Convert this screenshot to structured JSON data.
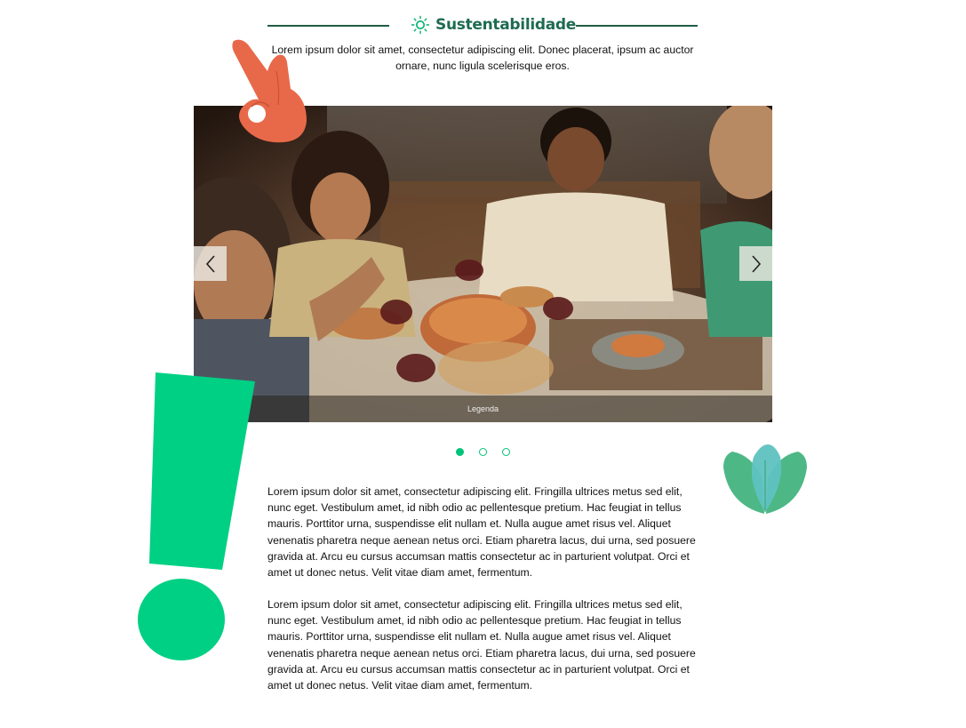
{
  "header": {
    "title": "Sustentabilidade",
    "icon": "sun-icon",
    "intro": "Lorem ipsum dolor sit amet, consectetur adipiscing elit. Donec placerat, ipsum ac auctor ornare, nunc ligula scelerisque eros."
  },
  "carousel": {
    "caption": "Legenda",
    "prev_icon": "chevron-left-icon",
    "next_icon": "chevron-right-icon",
    "slides_total": 3,
    "active_slide": 1
  },
  "body": {
    "paragraphs": [
      "Lorem ipsum dolor sit amet, consectetur adipiscing elit. Fringilla ultrices metus sed elit, nunc eget. Vestibulum amet, id nibh odio ac pellentesque pretium. Hac feugiat in tellus mauris. Porttitor urna, suspendisse elit nullam et. Nulla augue amet risus vel. Aliquet venenatis pharetra neque aenean netus orci. Etiam pharetra lacus, dui urna, sed posuere gravida at. Arcu eu cursus accumsan mattis consectetur ac in parturient volutpat. Orci et amet ut donec netus. Velit vitae diam amet, fermentum.",
      "Lorem ipsum dolor sit amet, consectetur adipiscing elit. Fringilla ultrices metus sed elit, nunc eget. Vestibulum amet, id nibh odio ac pellentesque pretium. Hac feugiat in tellus mauris. Porttitor urna, suspendisse elit nullam et. Nulla augue amet risus vel. Aliquet venenatis pharetra neque aenean netus orci. Etiam pharetra lacus, dui urna, sed posuere gravida at. Arcu eu cursus accumsan mattis consectetur ac in parturient volutpat. Orci et amet ut donec netus. Velit vitae diam amet, fermentum."
    ]
  },
  "decorations": {
    "hand": "ok-hand-icon",
    "exclamation": "exclamation-mark-icon",
    "leaves": "leaf-heart-icon"
  },
  "colors": {
    "title_green": "#1e6b50",
    "accent_green": "#00c37a",
    "hand_orange": "#e8694a"
  }
}
